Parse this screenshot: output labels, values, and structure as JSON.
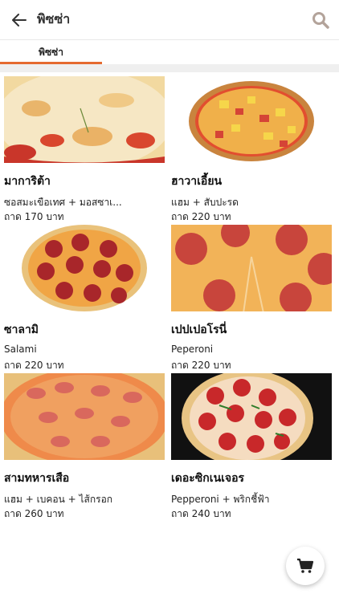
{
  "header": {
    "title": "พิซซ่า"
  },
  "tabs": [
    {
      "label": "พิซซ่า"
    }
  ],
  "colors": {
    "accent": "#e56a2f"
  },
  "products": [
    {
      "name": "มาการิต้า",
      "desc": "ซอสมะเขือเทศ + มอสซาเ...",
      "price": "ถาด 170 บาท"
    },
    {
      "name": "ฮาวาเอี้ยน",
      "desc": "แฮม + สับปะรด",
      "price": "ถาด 220 บาท"
    },
    {
      "name": "ซาลามิ",
      "desc": "Salami",
      "price": "ถาด 220 บาท"
    },
    {
      "name": "เปปเปอโรนี่",
      "desc": "Peperoni",
      "price": "ถาด 220 บาท"
    },
    {
      "name": "สามทหารเสือ",
      "desc": "แฮม + เบคอน + ไส้กรอก",
      "price": "ถาด 260 บาท"
    },
    {
      "name": "เดอะซิกเนเจอร",
      "desc": "Pepperoni + พริกชี้ฟ้า",
      "price": "ถาด 240 บาท"
    }
  ],
  "icons": {
    "back": "arrow-left-icon",
    "search": "search-icon",
    "cart": "cart-icon"
  }
}
